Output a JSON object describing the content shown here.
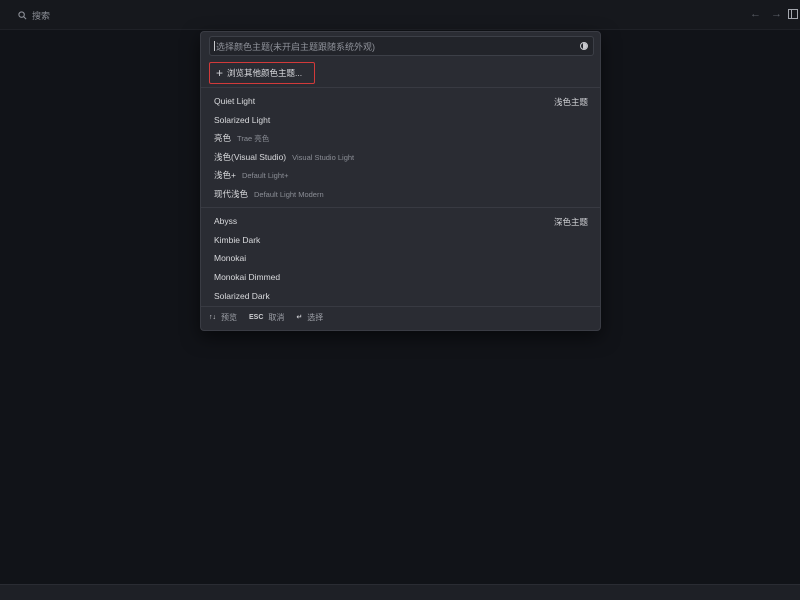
{
  "topbar": {
    "search_label": "搜索"
  },
  "palette": {
    "input_placeholder": "选择颜色主题(未开启主题跟随系统外观)",
    "browse_label": "浏览其他颜色主题...",
    "light_group_label": "浅色主题",
    "dark_group_label": "深色主题",
    "light_items": [
      {
        "label": "Quiet Light",
        "desc": ""
      },
      {
        "label": "Solarized Light",
        "desc": ""
      },
      {
        "label": "亮色",
        "desc": "Trae 亮色"
      },
      {
        "label": "浅色(Visual Studio)",
        "desc": "Visual Studio Light"
      },
      {
        "label": "浅色+",
        "desc": "Default Light+"
      },
      {
        "label": "现代浅色",
        "desc": "Default Light Modern"
      }
    ],
    "dark_items": [
      {
        "label": "Abyss"
      },
      {
        "label": "Kimbie Dark"
      },
      {
        "label": "Monokai"
      },
      {
        "label": "Monokai Dimmed"
      },
      {
        "label": "Solarized Dark"
      }
    ],
    "footer": {
      "preview_key": "↑↓",
      "preview_label": "预览",
      "cancel_key": "ESC",
      "cancel_label": "取消",
      "select_key": "↵",
      "select_label": "选择"
    }
  },
  "colors": {
    "background": "#111318",
    "palette_bg": "#2a2c33",
    "highlight_border": "#d23a3a"
  }
}
